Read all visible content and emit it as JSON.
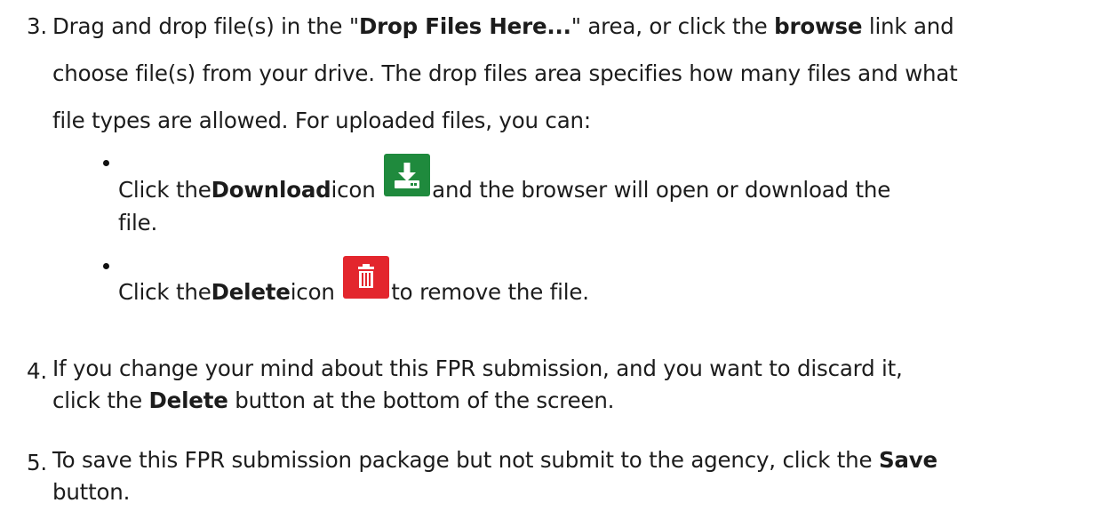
{
  "step3": {
    "number": "3.",
    "l1_pre": "Drag and drop file(s) in the \"",
    "l1_b1": "Drop Files Here...",
    "l1_mid": "\" area, or click the ",
    "l1_b2": "browse",
    "l1_post": " link and",
    "l2": "choose file(s) from your drive. The drop files area specifies how many files and what",
    "l3": "file types are allowed. For uploaded files, you can:",
    "bullets": [
      {
        "pre": "Click the ",
        "bold": "Download",
        "mid": " icon",
        "post": " and the browser will open or download the",
        "cont": "file.",
        "icon": "download-icon",
        "icon_color": "#1f8a3d"
      },
      {
        "pre": "Click the ",
        "bold": "Delete",
        "mid": " icon",
        "post": " to remove the file.",
        "icon": "trash-icon",
        "icon_color": "#e3262d"
      }
    ]
  },
  "step4": {
    "number": "4.",
    "l1": "If you change your mind about this FPR submission, and you want to discard it,",
    "l2_pre": "click the ",
    "l2_bold": "Delete",
    "l2_post": " button at the bottom of the screen."
  },
  "step5": {
    "number": "5.",
    "l1_pre": "To save this FPR submission package but not submit to the agency, click the ",
    "l1_bold": "Save",
    "l2": "button."
  }
}
